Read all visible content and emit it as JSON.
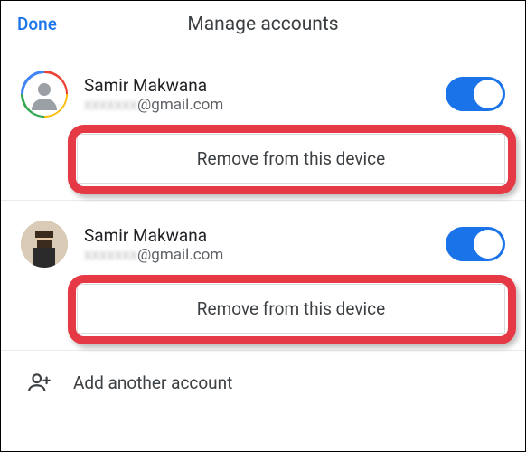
{
  "header": {
    "done_label": "Done",
    "title": "Manage accounts"
  },
  "accounts": [
    {
      "name": "Samir Makwana",
      "email_local": "xxxxxxx",
      "email_domain": "@gmail.com",
      "remove_label": "Remove from this device",
      "toggle_on": true,
      "avatar_type": "ring-silhouette"
    },
    {
      "name": "Samir Makwana",
      "email_local": "xxxxxxx",
      "email_domain": "@gmail.com",
      "remove_label": "Remove from this device",
      "toggle_on": true,
      "avatar_type": "photo"
    }
  ],
  "add_another": {
    "label": "Add another account",
    "icon": "person-add-icon"
  },
  "highlight_color": "#e63946",
  "accent_color": "#1a73e8"
}
